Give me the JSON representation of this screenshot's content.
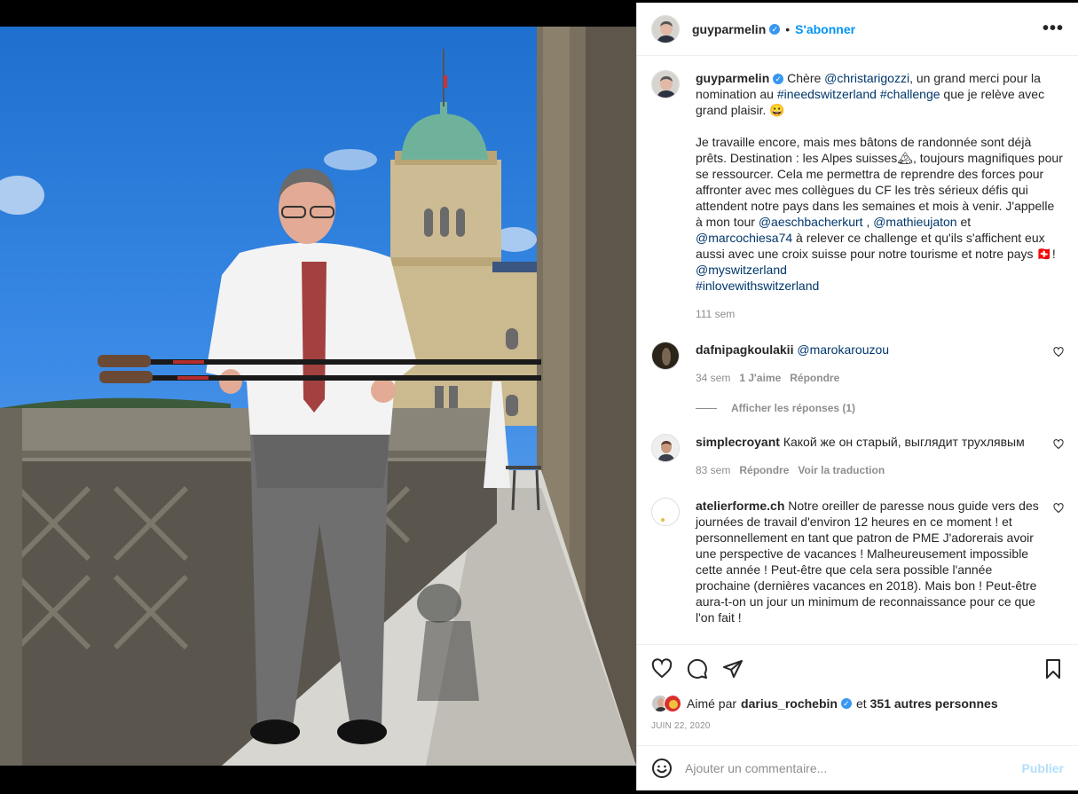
{
  "post": {
    "author": "guyparmelin",
    "verified_mark": "✓",
    "separator": "•",
    "follow_label": "S'abonner",
    "more_label": "•••",
    "caption": {
      "author": "guyparmelin",
      "text_1": "Chère ",
      "mention_1": "@christarigozzi",
      "text_2": ", un grand merci pour la nomination au ",
      "hashtag_1": "#ineedswitzerland",
      "text_3": " ",
      "hashtag_2": "#challenge",
      "text_4": " que je relève avec grand plaisir. 😀",
      "para_2_a": "Je travaille encore, mais mes bâtons de randonnée sont déjà prêts. Destination : les Alpes suisses🏔, toujours magnifiques pour se ressourcer. Cela me permettra de reprendre des forces pour affronter avec mes collègues du CF les très sérieux défis qui attendent notre pays dans les semaines et mois à venir.",
      "para_2_b": "J'appelle à mon tour ",
      "mention_2": "@aeschbacherkurt",
      "text_5": " , ",
      "mention_3": "@mathieujaton",
      "text_6": " et ",
      "mention_4": "@marcochiesa74",
      "text_7": " à relever ce challenge et qu'ils s'affichent eux aussi avec une croix suisse pour notre tourisme et notre pays 🇨🇭!",
      "mention_5": "@myswitzerland",
      "hashtag_3": "#inlovewithswitzerland",
      "time": "111 sem"
    },
    "comments": [
      {
        "user": "dafnipagkoulakii",
        "text_mention": "@marokarouzou",
        "time": "34 sem",
        "likes": "1 J'aime",
        "reply": "Répondre",
        "view_replies": "Afficher les réponses (1)"
      },
      {
        "user": "simplecroyant",
        "text": "Какой же он старый, выглядит трухлявым",
        "time": "83 sem",
        "reply": "Répondre",
        "translate": "Voir la traduction"
      },
      {
        "user": "atelierforme.ch",
        "text": "Notre oreiller de paresse nous guide vers des journées de travail d'environ 12 heures en ce moment ! et personnellement en tant que patron de PME J'adorerais avoir une perspective de vacances ! Malheureusement impossible cette année ! Peut-être que cela sera possible l'année prochaine (dernières vacances en 2018). Mais bon ! Peut-être aura-t-on un jour un minimum de reconnaissance pour ce que l'on fait !"
      }
    ],
    "liked_by_prefix": "Aimé par",
    "liked_by_user": "darius_rochebin",
    "liked_by_and": "et",
    "liked_by_others": "351 autres personnes",
    "date": "JUIN 22, 2020",
    "comment_placeholder": "Ajouter un commentaire...",
    "publish_label": "Publier",
    "emoji_icon": "smiley-icon",
    "colors": {
      "link": "#00376b",
      "follow": "#0095f6",
      "verified": "#3897f0",
      "muted": "#8e8e8e",
      "publish_disabled": "#b2dffc"
    }
  }
}
